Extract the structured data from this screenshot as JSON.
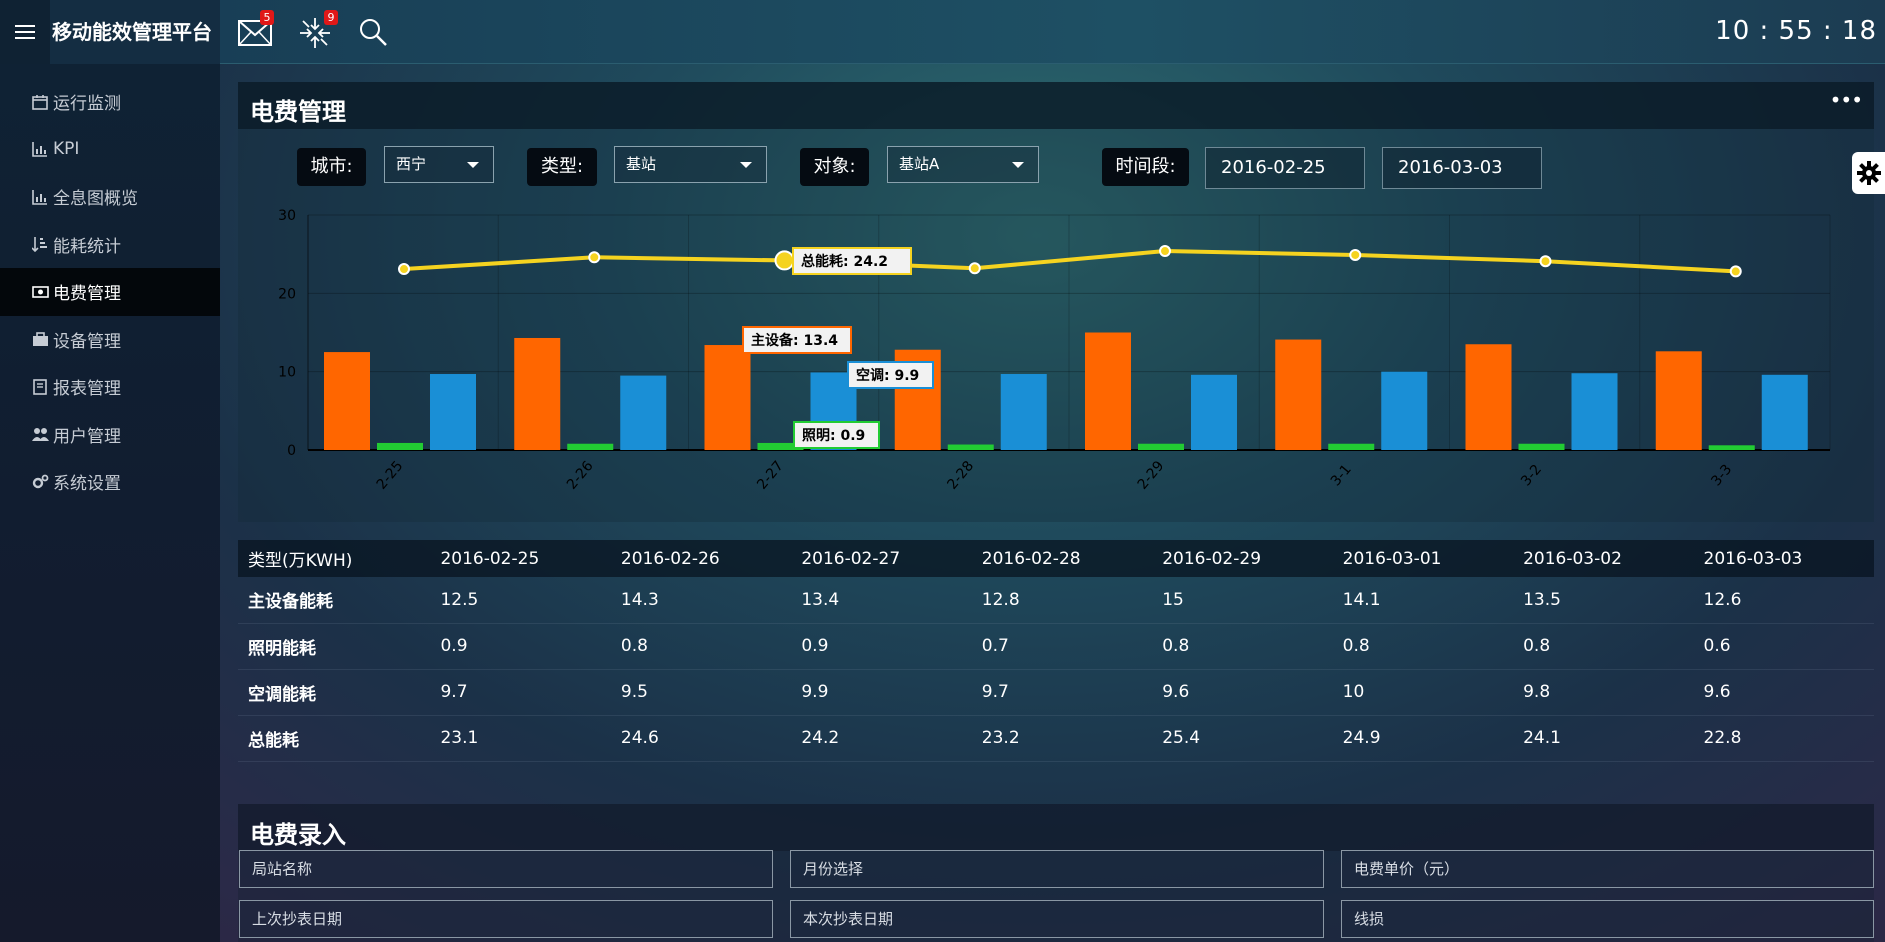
{
  "app": {
    "title": "移动能效管理平台",
    "time": "10 : 55 : 18"
  },
  "topbar": {
    "mail_badge": "5",
    "alert_badge": "9"
  },
  "sidebar": {
    "items": [
      {
        "label": "运行监测",
        "icon": "calendar-icon"
      },
      {
        "label": "KPI",
        "icon": "chart-icon"
      },
      {
        "label": "全息图概览",
        "icon": "chart-icon"
      },
      {
        "label": "能耗统计",
        "icon": "sort-amount-icon"
      },
      {
        "label": "电费管理",
        "icon": "money-icon",
        "active": true
      },
      {
        "label": "设备管理",
        "icon": "briefcase-icon"
      },
      {
        "label": "报表管理",
        "icon": "book-icon"
      },
      {
        "label": "用户管理",
        "icon": "users-icon"
      },
      {
        "label": "系统设置",
        "icon": "cogs-icon"
      }
    ]
  },
  "panel": {
    "title": "电费管理",
    "filters": {
      "city_label": "城市:",
      "city_value": "西宁",
      "type_label": "类型:",
      "type_value": "基站",
      "target_label": "对象:",
      "target_value": "基站A",
      "period_label": "时间段:",
      "start_date": "2016-02-25",
      "end_date": "2016-03-03"
    }
  },
  "chart_data": {
    "type": "bar",
    "categories": [
      "2-25",
      "2-26",
      "2-27",
      "2-28",
      "2-29",
      "3-1",
      "3-2",
      "3-3"
    ],
    "series": [
      {
        "name": "主设备",
        "type": "bar",
        "color": "#ff6600",
        "values": [
          12.5,
          14.3,
          13.4,
          12.8,
          15,
          14.1,
          13.5,
          12.6
        ]
      },
      {
        "name": "照明",
        "type": "bar",
        "color": "#22cc33",
        "values": [
          0.9,
          0.8,
          0.9,
          0.7,
          0.8,
          0.8,
          0.8,
          0.6
        ]
      },
      {
        "name": "空调",
        "type": "bar",
        "color": "#1a8fd6",
        "values": [
          9.7,
          9.5,
          9.9,
          9.7,
          9.6,
          10,
          9.8,
          9.6
        ]
      },
      {
        "name": "总能耗",
        "type": "line",
        "color": "#f5d320",
        "values": [
          23.1,
          24.6,
          24.2,
          23.2,
          25.4,
          24.9,
          24.1,
          22.8
        ]
      }
    ],
    "ylim": [
      0,
      30
    ],
    "yticks": [
      0,
      10,
      20,
      30
    ],
    "grid": true,
    "tooltips": [
      {
        "label": "总能耗:",
        "value": "24.2"
      },
      {
        "label": "主设备:",
        "value": "13.4"
      },
      {
        "label": "空调:",
        "value": "9.9"
      },
      {
        "label": "照明:",
        "value": "0.9"
      }
    ]
  },
  "table": {
    "header": [
      "类型(万KWH)",
      "2016-02-25",
      "2016-02-26",
      "2016-02-27",
      "2016-02-28",
      "2016-02-29",
      "2016-03-01",
      "2016-03-02",
      "2016-03-03"
    ],
    "rows": [
      [
        "主设备能耗",
        "12.5",
        "14.3",
        "13.4",
        "12.8",
        "15",
        "14.1",
        "13.5",
        "12.6"
      ],
      [
        "照明能耗",
        "0.9",
        "0.8",
        "0.9",
        "0.7",
        "0.8",
        "0.8",
        "0.8",
        "0.6"
      ],
      [
        "空调能耗",
        "9.7",
        "9.5",
        "9.9",
        "9.7",
        "9.6",
        "10",
        "9.8",
        "9.6"
      ],
      [
        "总能耗",
        "23.1",
        "24.6",
        "24.2",
        "23.2",
        "25.4",
        "24.9",
        "24.1",
        "22.8"
      ]
    ]
  },
  "form": {
    "title": "电费录入",
    "fields": {
      "station_name": "局站名称",
      "month": "月份选择",
      "unit_price": "电费单价（元）",
      "last_date": "上次抄表日期",
      "this_date": "本次抄表日期",
      "line_loss": "线损"
    }
  }
}
